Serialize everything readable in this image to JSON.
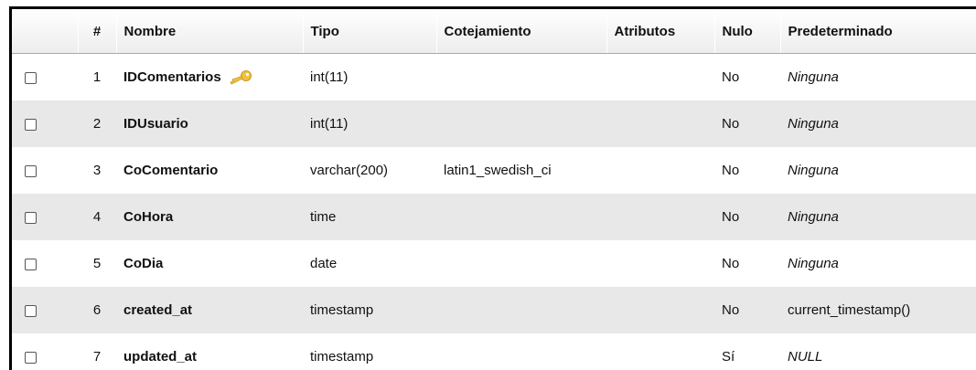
{
  "table": {
    "headers": {
      "select": "",
      "index": "#",
      "name": "Nombre",
      "type": "Tipo",
      "collation": "Cotejamiento",
      "attributes": "Atributos",
      "null": "Nulo",
      "default": "Predeterminado"
    },
    "rows": [
      {
        "index": "1",
        "name": "IDComentarios",
        "primary_key_icon": "key-icon",
        "type": "int(11)",
        "collation": "",
        "attributes": "",
        "null": "No",
        "default": "Ninguna",
        "default_italic": true
      },
      {
        "index": "2",
        "name": "IDUsuario",
        "type": "int(11)",
        "collation": "",
        "attributes": "",
        "null": "No",
        "default": "Ninguna",
        "default_italic": true
      },
      {
        "index": "3",
        "name": "CoComentario",
        "type": "varchar(200)",
        "collation": "latin1_swedish_ci",
        "attributes": "",
        "null": "No",
        "default": "Ninguna",
        "default_italic": true
      },
      {
        "index": "4",
        "name": "CoHora",
        "type": "time",
        "collation": "",
        "attributes": "",
        "null": "No",
        "default": "Ninguna",
        "default_italic": true
      },
      {
        "index": "5",
        "name": "CoDia",
        "type": "date",
        "collation": "",
        "attributes": "",
        "null": "No",
        "default": "Ninguna",
        "default_italic": true
      },
      {
        "index": "6",
        "name": "created_at",
        "type": "timestamp",
        "collation": "",
        "attributes": "",
        "null": "No",
        "default": "current_timestamp()",
        "default_italic": false
      },
      {
        "index": "7",
        "name": "updated_at",
        "type": "timestamp",
        "collation": "",
        "attributes": "",
        "null": "Sí",
        "default": "NULL",
        "default_italic": true
      }
    ]
  },
  "colors": {
    "row_alt": "#e8e8e8",
    "key_icon": "#f0c040"
  }
}
